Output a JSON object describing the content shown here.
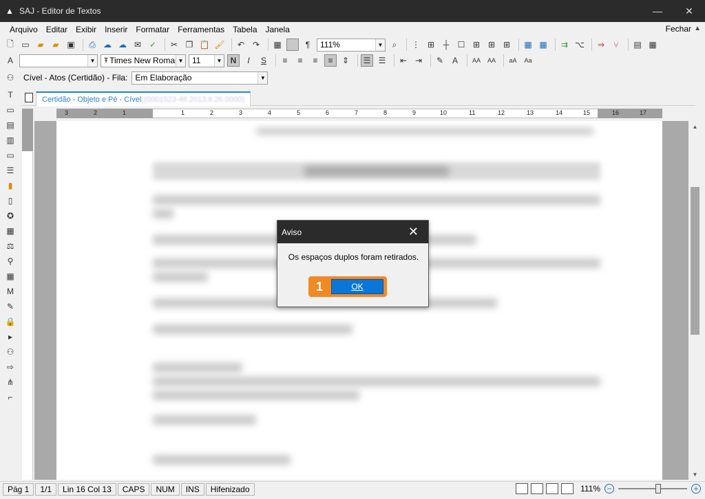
{
  "window": {
    "title": "SAJ - Editor de Textos"
  },
  "menu": {
    "items": [
      "Arquivo",
      "Editar",
      "Exibir",
      "Inserir",
      "Formatar",
      "Ferramentas",
      "Tabela",
      "Janela"
    ],
    "close_label": "Fechar"
  },
  "toolbar1": {
    "zoom_value": "111%"
  },
  "toolbar2": {
    "style_value": "",
    "font_value": "Times New Romar",
    "size_value": "11",
    "bold": "N",
    "italic": "I",
    "underline": "S"
  },
  "queue_bar": {
    "label": "Cível - Atos (Certidão) - Fila:",
    "queue_value": "Em Elaboração"
  },
  "tab": {
    "label": "Certidão - Objeto e Pé - Cível",
    "blurred_id": "(0001523-48.2013.8.26.0000)"
  },
  "ruler": {
    "numbers": [
      "3",
      "2",
      "1",
      "1",
      "2",
      "3",
      "4",
      "5",
      "6",
      "7",
      "8",
      "9",
      "10",
      "11",
      "12",
      "13",
      "14",
      "15",
      "16",
      "17"
    ]
  },
  "dialog": {
    "title": "Aviso",
    "message": "Os espaços duplos foram retirados.",
    "step_number": "1",
    "ok_label": "OK"
  },
  "status": {
    "page": "Pág 1",
    "pages": "1/1",
    "line_col": "Lin 16  Col 13",
    "caps": "CAPS",
    "num": "NUM",
    "ins": "INS",
    "hyphen": "Hifenizado",
    "zoom": "111%"
  }
}
